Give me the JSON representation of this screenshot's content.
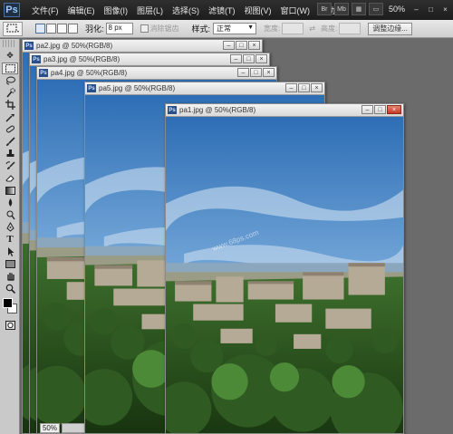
{
  "app": {
    "logo": "Ps",
    "menu": [
      "文件(F)",
      "编辑(E)",
      "图像(I)",
      "图层(L)",
      "选择(S)",
      "滤镜(T)",
      "视图(V)",
      "窗口(W)",
      "帮助(H)"
    ],
    "right_icons": [
      "Br",
      "Mb"
    ],
    "zoom": "50%",
    "window_controls": [
      "–",
      "□",
      "×"
    ]
  },
  "options": {
    "feather_label": "羽化:",
    "feather_value": "8 px",
    "antialias_label": "消除锯齿",
    "style_label": "样式:",
    "style_value": "正常",
    "width_label": "宽度:",
    "height_label": "高度:",
    "refine_label": "调整边缘..."
  },
  "tools": [
    "move-icon",
    "marquee-icon",
    "lasso-icon",
    "quick-select-icon",
    "crop-icon",
    "eyedropper-icon",
    "healing-icon",
    "brush-icon",
    "clone-stamp-icon",
    "history-brush-icon",
    "eraser-icon",
    "gradient-icon",
    "blur-icon",
    "dodge-icon",
    "pen-icon",
    "type-icon",
    "path-select-icon",
    "shape-icon",
    "hand-icon",
    "zoom-icon"
  ],
  "documents": [
    {
      "title": "pa2.jpg @ 50%(RGB/8)"
    },
    {
      "title": "pa3.jpg @ 50%(RGB/8)"
    },
    {
      "title": "pa4.jpg @ 50%(RGB/8)"
    },
    {
      "title": "pa5.jpg @ 50%(RGB/8)"
    },
    {
      "title": "pa1.jpg @ 50%(RGB/8)"
    }
  ],
  "status": {
    "zoom": "50%"
  },
  "watermark": "www.68ps.com"
}
